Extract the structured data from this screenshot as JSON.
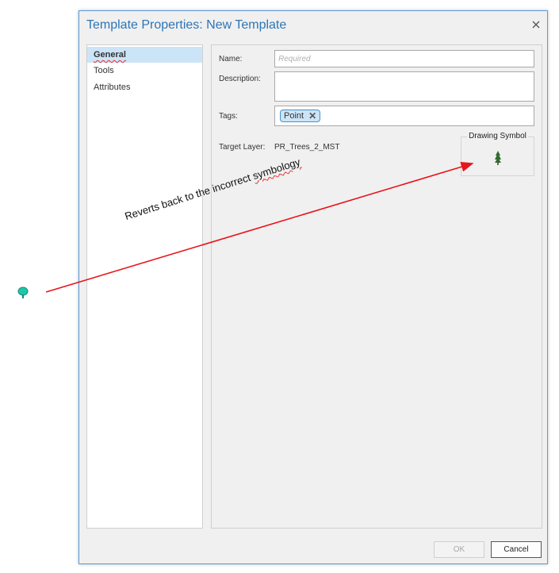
{
  "dialog": {
    "title": "Template Properties: New Template"
  },
  "nav": {
    "items": [
      {
        "label": "General",
        "selected": true
      },
      {
        "label": "Tools",
        "selected": false
      },
      {
        "label": "Attributes",
        "selected": false
      }
    ]
  },
  "general": {
    "name_label": "Name:",
    "name_value": "",
    "name_placeholder": "Required",
    "description_label": "Description:",
    "description_value": "",
    "tags_label": "Tags:",
    "tags": [
      "Point"
    ],
    "target_layer_label": "Target Layer:",
    "target_layer_value": "PR_Trees_2_MST",
    "drawing_symbol_title": "Drawing Symbol"
  },
  "buttons": {
    "ok_label": "OK",
    "ok_enabled": false,
    "cancel_label": "Cancel"
  },
  "annotation": {
    "text_before": "Reverts back to the incorrect ",
    "text_squiggle": "symbology",
    "arrow_color": "#e8141b"
  },
  "colors": {
    "accent": "#2e75b6",
    "selection": "#cce4f7",
    "tag_border": "#4a90c8",
    "tree_symbol_correct": "#2f6b2f",
    "tree_symbol_incorrect": "#1fc7a8"
  },
  "icons": {
    "close": "close-icon",
    "tag_remove": "tag-remove-icon",
    "drawing_symbol": "conifer-tree-icon",
    "map_symbol": "round-tree-icon"
  }
}
